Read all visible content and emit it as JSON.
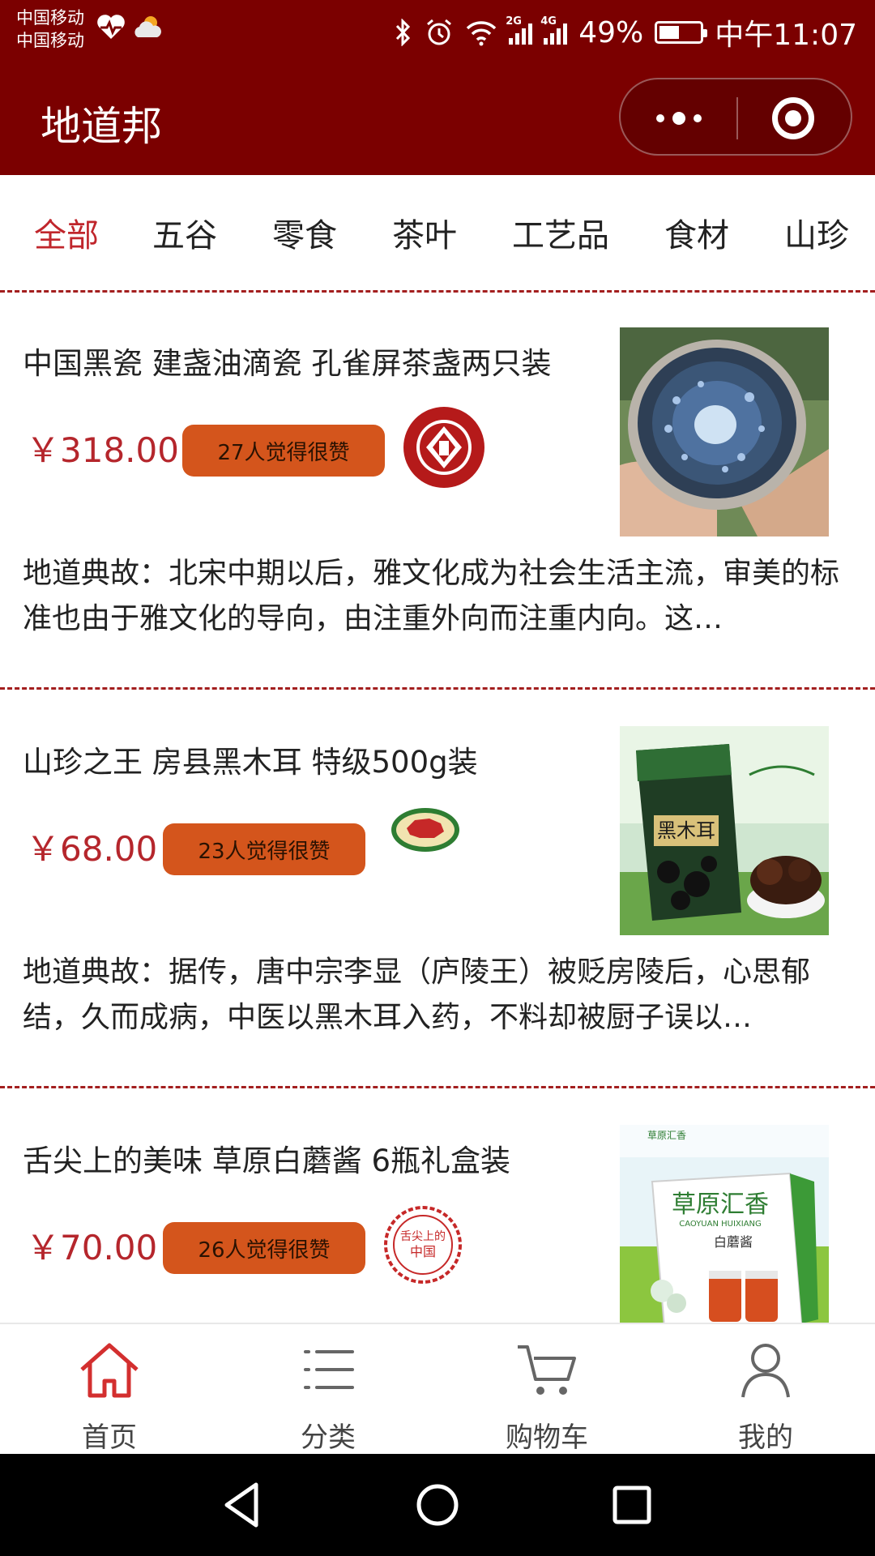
{
  "status_bar": {
    "carrier_1": "中国移动",
    "carrier_2": "中国移动",
    "battery_percent": "49%",
    "battery_level": 0.49,
    "time": "中午11:07",
    "network_1": "2G",
    "network_2": "4G"
  },
  "app": {
    "title": "地道邦"
  },
  "tabs": [
    "全部",
    "五谷",
    "零食",
    "茶叶",
    "工艺品",
    "食材",
    "山珍"
  ],
  "active_tab": "全部",
  "products": [
    {
      "title": "中国黑瓷 建盏油滴瓷 孔雀屏茶盏两只装",
      "price": "￥318.00",
      "likes": "27人觉得很赞",
      "story": "地道典故：北宋中期以后，雅文化成为社会生活主流，审美的标准也由于雅文化的导向，由注重外向而注重内向。这…"
    },
    {
      "title": "山珍之王 房县黑木耳 特级500g装",
      "price": "￥68.00",
      "likes": "23人觉得很赞",
      "story": "地道典故：据传，唐中宗李显（庐陵王）被贬房陵后，心思郁结，久而成病，中医以黑木耳入药，不料却被厨子误以…",
      "image_text": "黑木耳"
    },
    {
      "title": "舌尖上的美味 草原白蘑酱 6瓶礼盒装",
      "price": "￥70.00",
      "likes": "26人觉得很赞",
      "seal_text_1": "舌尖上的",
      "seal_text_2": "中国",
      "image_brand": "草原汇香",
      "image_brand_en": "CAOYUAN HUIXIANG",
      "image_product": "白蘑酱"
    }
  ],
  "bottom_nav": [
    {
      "label": "首页",
      "icon": "home-icon",
      "active": true
    },
    {
      "label": "分类",
      "icon": "list-icon",
      "active": false
    },
    {
      "label": "购物车",
      "icon": "cart-icon",
      "active": false
    },
    {
      "label": "我的",
      "icon": "user-icon",
      "active": false
    }
  ],
  "colors": {
    "header": "#7b0000",
    "accent": "#c0262c",
    "price": "#b5262c",
    "likes_button": "#d4551c"
  }
}
